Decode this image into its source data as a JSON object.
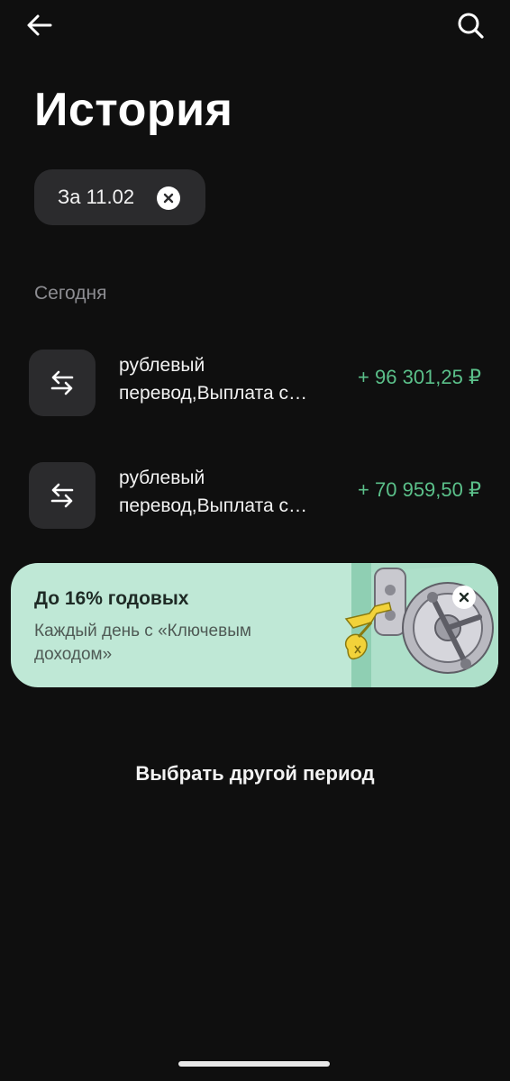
{
  "header": {
    "back_icon": "arrow-left-icon",
    "search_icon": "search-icon",
    "title": "История"
  },
  "filter": {
    "label": "За 11.02",
    "clear_icon": "close-circle-icon"
  },
  "section": {
    "label": "Сегодня"
  },
  "transactions": [
    {
      "icon": "transfer-arrows-icon",
      "title_line1": "рублевый",
      "title_line2": "перевод,Выплата с…",
      "amount": "+ 96 301,25 ₽"
    },
    {
      "icon": "transfer-arrows-icon",
      "title_line1": "рублевый",
      "title_line2": "перевод,Выплата с…",
      "amount": "+ 70 959,50 ₽"
    }
  ],
  "promo": {
    "title": "До 16% годовых",
    "subtitle": "Каждый день с «Ключевым доходом»",
    "close_icon": "close-icon",
    "illustration": "safe-with-keys-illustration"
  },
  "footer": {
    "link": "Выбрать другой период"
  },
  "colors": {
    "background": "#0f0f0f",
    "card": "#2b2b2d",
    "income": "#5bc08a",
    "promo_bg": "#bfe8d6",
    "muted": "#8d8d92"
  }
}
